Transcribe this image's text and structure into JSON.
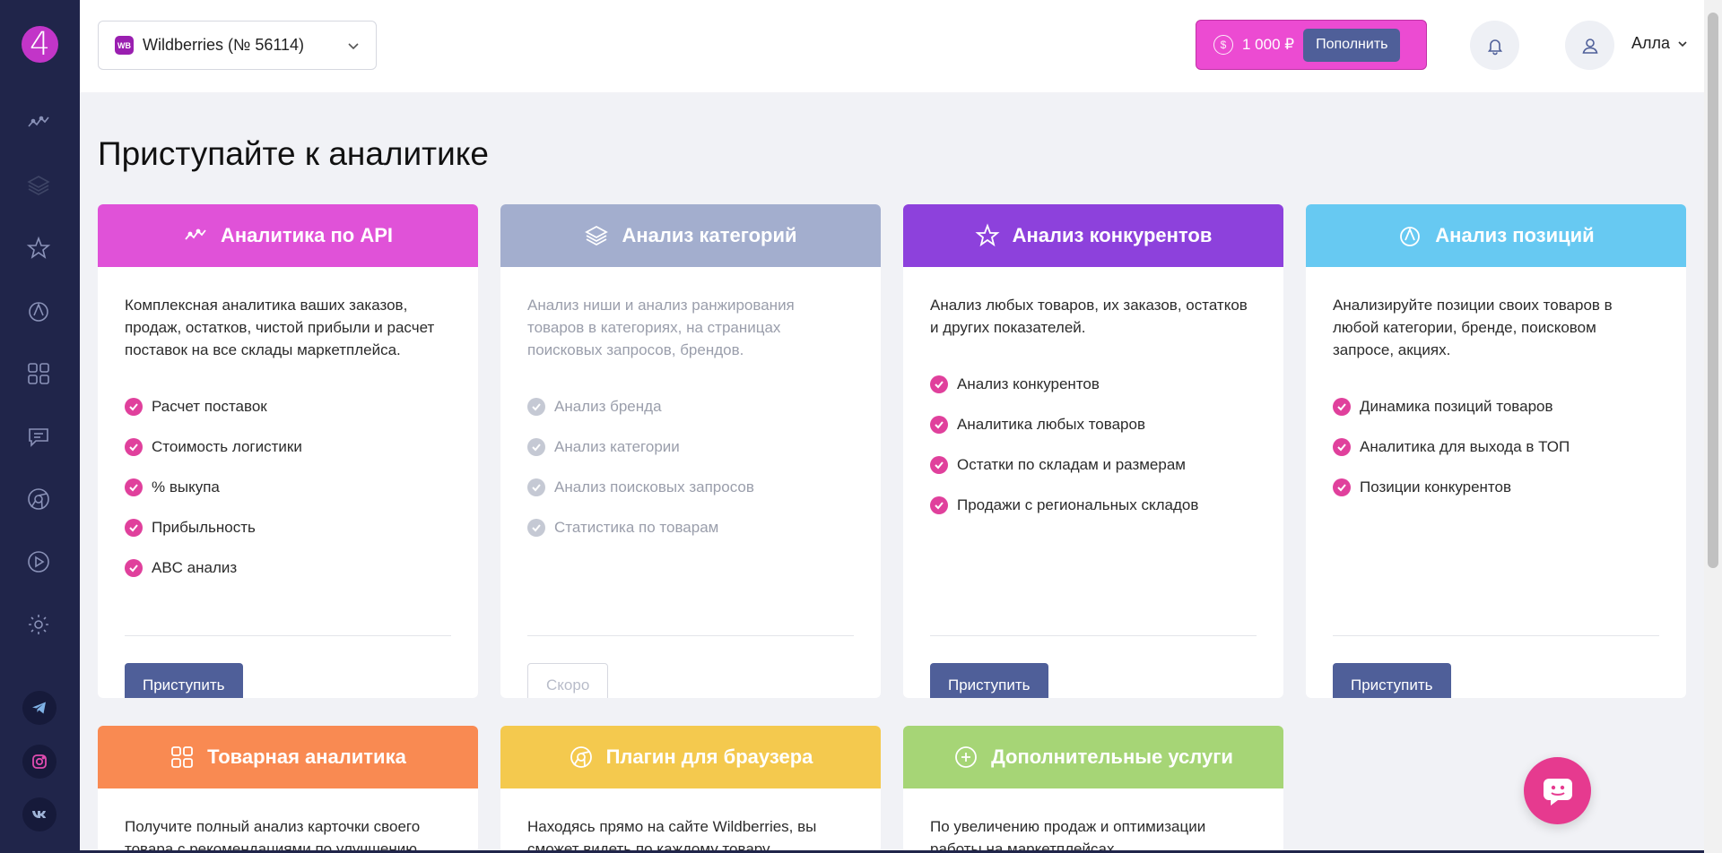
{
  "header": {
    "store_badge": "WB",
    "store_name": "Wildberries (№ 56114)",
    "balance": "1 000 ₽",
    "topup_label": "Пополнить",
    "user_name": "Алла"
  },
  "main": {
    "title": "Приступайте к аналитике"
  },
  "cards": [
    {
      "title": "Аналитика по API",
      "color": "#e052d8",
      "description": "Комплексная аналитика ваших заказов, продаж, остатков, чистой прибыли и расчет поставок на все склады маркетплейса.",
      "features": [
        "Расчет поставок",
        "Стоимость логистики",
        "% выкупа",
        "Прибыльность",
        "ABC анализ"
      ],
      "button": "Приступить"
    },
    {
      "title": "Анализ категорий",
      "color": "#a3aece",
      "description": "Анализ ниши и анализ ранжирования товаров в категориях, на страницах поисковых запросов, брендов.",
      "features": [
        "Анализ бренда",
        "Анализ категории",
        "Анализ поисковых запросов",
        "Статистика по товарам"
      ],
      "button": "Скоро"
    },
    {
      "title": "Анализ конкурентов",
      "color": "#8d41dc",
      "description": "Анализ любых товаров, их заказов, остатков и других показателей.",
      "features": [
        "Анализ конкурентов",
        "Аналитика любых товаров",
        "Остатки по складам и размерам",
        "Продажи с региональных складов"
      ],
      "button": "Приступить"
    },
    {
      "title": "Анализ позиций",
      "color": "#67c9f2",
      "description": "Анализируйте позиции своих товаров в любой категории, бренде, поисковом запросе, акциях.",
      "features": [
        "Динамика позиций товаров",
        "Аналитика для выхода в ТОП",
        "Позиции конкурентов"
      ],
      "button": "Приступить"
    },
    {
      "title": "Товарная аналитика",
      "color": "#f98a52",
      "description": "Получите полный анализ карточки своего товара с рекомендациями по улучшению"
    },
    {
      "title": "Плагин для браузера",
      "color": "#f4c94e",
      "description": "Находясь прямо на сайте Wildberries, вы сможет видеть по каждому товару"
    },
    {
      "title": "Дополнительные услуги",
      "color": "#a6d576",
      "description": "По увеличению продаж и оптимизации работы на маркетплейсах"
    }
  ],
  "sidebar": {
    "icons": [
      "analytics-icon",
      "layers-icon",
      "star-icon",
      "position-icon",
      "grid-icon",
      "chat-icon",
      "chrome-icon",
      "play-icon",
      "settings-icon"
    ],
    "social": [
      "telegram-icon",
      "instagram-icon",
      "vk-icon"
    ]
  }
}
